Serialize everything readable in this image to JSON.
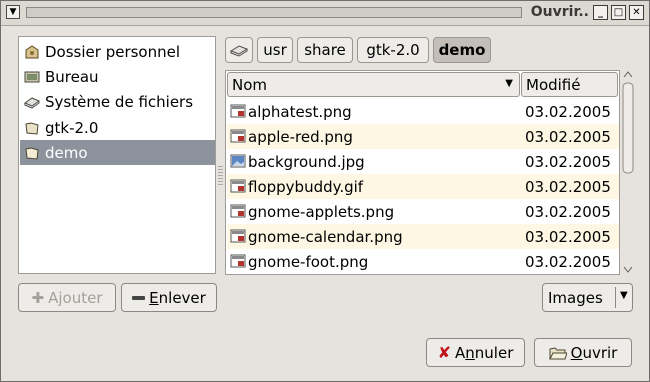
{
  "window": {
    "title": "Ouvrir..",
    "menu_icon": "menu-arrow-icon",
    "controls": [
      "minimize-icon",
      "maximize-icon",
      "close-icon"
    ]
  },
  "places": [
    {
      "label": "Dossier personnel",
      "icon": "home-folder-icon"
    },
    {
      "label": "Bureau",
      "icon": "desktop-icon"
    },
    {
      "label": "Système de fichiers",
      "icon": "drive-icon"
    },
    {
      "label": "gtk-2.0",
      "icon": "folder-icon"
    },
    {
      "label": "demo",
      "icon": "folder-icon",
      "selected": true
    }
  ],
  "pathbar": {
    "root_icon": "drive-icon",
    "segments": [
      "usr",
      "share",
      "gtk-2.0",
      "demo"
    ],
    "current": "demo"
  },
  "columns": {
    "name": "Nom",
    "modified": "Modifié"
  },
  "files": [
    {
      "name": "alphatest.png",
      "date": "03.02.2005"
    },
    {
      "name": "apple-red.png",
      "date": "03.02.2005"
    },
    {
      "name": "background.jpg",
      "date": "03.02.2005"
    },
    {
      "name": "floppybuddy.gif",
      "date": "03.02.2005"
    },
    {
      "name": "gnome-applets.png",
      "date": "03.02.2005"
    },
    {
      "name": "gnome-calendar.png",
      "date": "03.02.2005"
    },
    {
      "name": "gnome-foot.png",
      "date": "03.02.2005"
    }
  ],
  "buttons": {
    "add": "Ajouter",
    "remove_prefix": "",
    "remove_mnemonic": "E",
    "remove_rest": "nlever",
    "filter": "Images",
    "cancel_prefix": "A",
    "cancel_mnemonic": "n",
    "cancel_rest": "nuler",
    "open_mnemonic": "O",
    "open_rest": "uvrir"
  },
  "colors": {
    "selection": "#8d939d",
    "alt_row": "#fdf7e3",
    "cancel_icon": "#c0161b"
  }
}
